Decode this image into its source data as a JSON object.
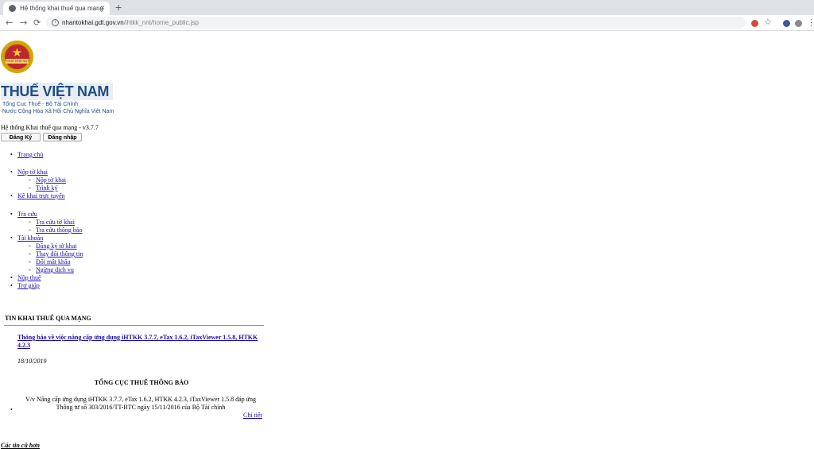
{
  "browser": {
    "tab_title": "Hệ thống khai thuế qua mạng",
    "tab_close": "×",
    "new_tab": "+",
    "url_host": "nhantokhai.gdt.gov.vn",
    "url_path": "/ihtkk_nnt/home_public.jsp",
    "back": "←",
    "forward": "→",
    "reload": "⟳",
    "bookmark": "☆",
    "menu": "⋮"
  },
  "header": {
    "emblem_text": "THUẾ NHÀ NƯỚC",
    "brand_title": "THUẾ VIỆT NAM",
    "brand_line1": "Tổng Cục Thuế - Bộ Tài Chính",
    "brand_line2": "Nước Cộng Hòa Xã Hội Chủ Nghĩa Việt Nam",
    "system_name": "Hệ thống Khai thuế qua mạng - v3.7.7",
    "register_label": "Đăng Ký",
    "login_label": "Đăng nhập"
  },
  "nav": {
    "home": "Trang chủ",
    "submit": "Nộp tờ khai",
    "submit_children": [
      "Nộp tờ khai",
      "Trình ký"
    ],
    "online_declare": "Kê khai trực tuyến",
    "lookup": "Tra cứu",
    "lookup_children": [
      "Tra cứu tờ khai",
      "Tra cứu thông báo"
    ],
    "account": "Tài khoản",
    "account_children": [
      "Đăng ký tờ khai",
      "Thay đổi thông tin",
      "Đổi mật khẩu",
      "Ngừng dịch vụ"
    ],
    "pay_tax": "Nộp thuế",
    "help": "Trợ giúp"
  },
  "news": {
    "header": "TIN KHAI THUẾ QUA MẠNG",
    "item_title": "Thông báo về việc nâng cấp ứng dụng iHTKK 3.7.7, eTax 1.6.2, iTaxViewer 1.5.8, HTKK 4.2.3",
    "item_date": "18/10/2019",
    "notice_title": "TỔNG CỤC THUẾ THÔNG BÁO",
    "notice_body": "V/v Nâng cấp ứng dụng iHTKK 3.7.7, eTax 1.6.2, HTKK 4.2.3, iTaxViewer 1.5.8 đáp ứng Thông tư số 303/2016/TT-BTC ngày 15/11/2016 của Bộ Tài chính",
    "detail_link": "Chi tiết",
    "older": "Các tin cũ hơn"
  }
}
